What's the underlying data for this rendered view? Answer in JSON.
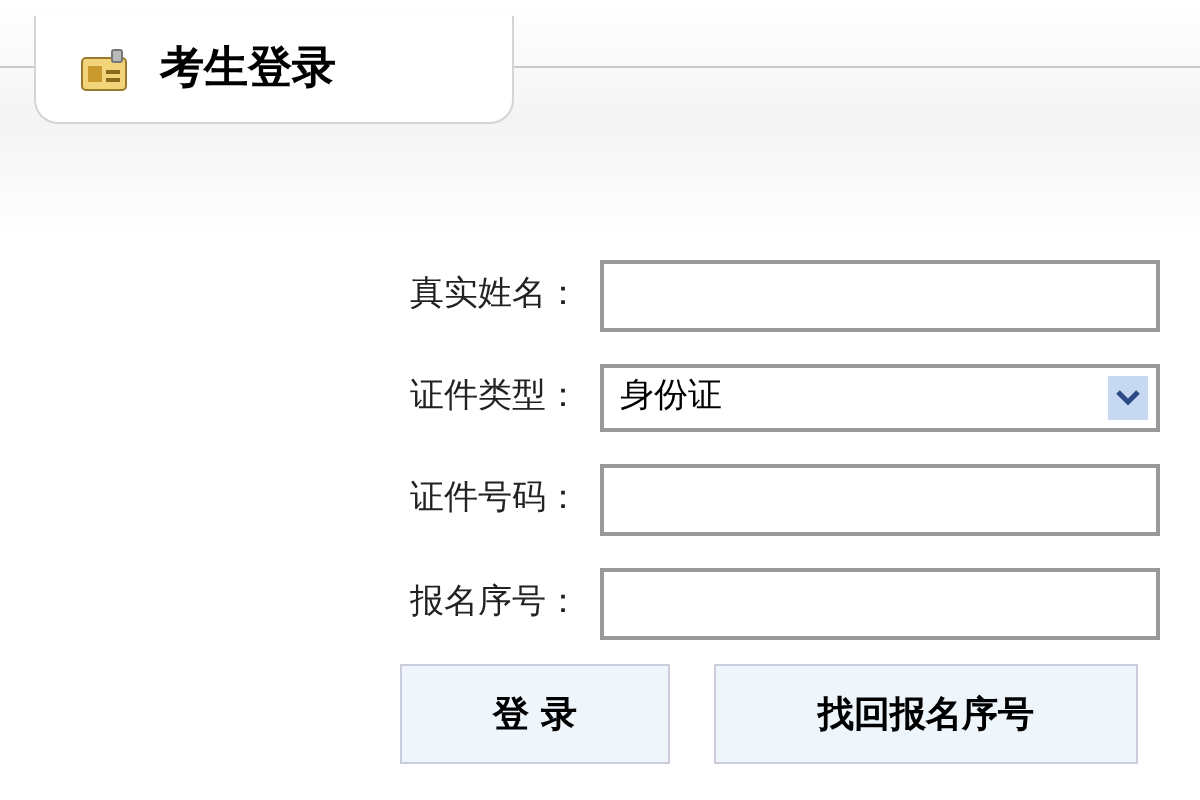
{
  "tab": {
    "title": "考生登录"
  },
  "fields": [
    {
      "label": "真实姓名：",
      "kind": "text"
    },
    {
      "label": "证件类型：",
      "kind": "select",
      "value": "身份证"
    },
    {
      "label": "证件号码：",
      "kind": "text"
    },
    {
      "label": "报名序号：",
      "kind": "text"
    }
  ],
  "buttons": [
    "登 录",
    "找回报名序号"
  ]
}
